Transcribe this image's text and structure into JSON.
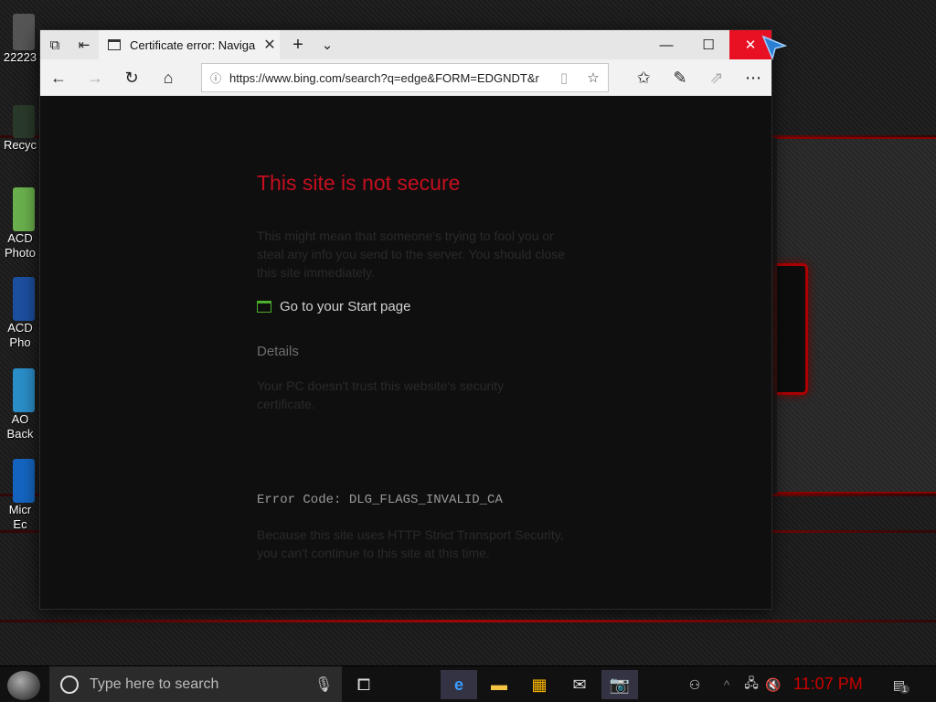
{
  "desktop": {
    "icons": [
      {
        "label": "22223"
      },
      {
        "label": "Recyc"
      },
      {
        "label": "ACD\nPhoto"
      },
      {
        "label": "ACD\nPho"
      },
      {
        "label": "AO\nBack"
      },
      {
        "label": "Micr\nEc"
      }
    ]
  },
  "browser": {
    "tab": {
      "title": "Certificate error: Naviga"
    },
    "address_bar": {
      "url": "https://www.bing.com/search?q=edge&FORM=EDGNDT&r"
    },
    "controls": {
      "minimize": "—",
      "maximize": "☐",
      "close": "✕"
    }
  },
  "error_page": {
    "title": "This site is not secure",
    "description": "This might mean that someone's trying to fool you or steal any info you send to the server. You should close this site immediately.",
    "start_link": "Go to your Start page",
    "details_label": "Details",
    "trust_text": "Your PC doesn't trust this website's security certificate.",
    "error_code": "Error Code: DLG_FLAGS_INVALID_CA",
    "hsts_text": "Because this site uses HTTP Strict Transport Security, you can't continue to this site at this time."
  },
  "taskbar": {
    "search_placeholder": "Type here to search",
    "clock": "11:07 PM",
    "notification_count": "1"
  },
  "colors": {
    "error_red": "#c50f1f",
    "close_red": "#e81123",
    "clock_red": "#cc0000"
  }
}
